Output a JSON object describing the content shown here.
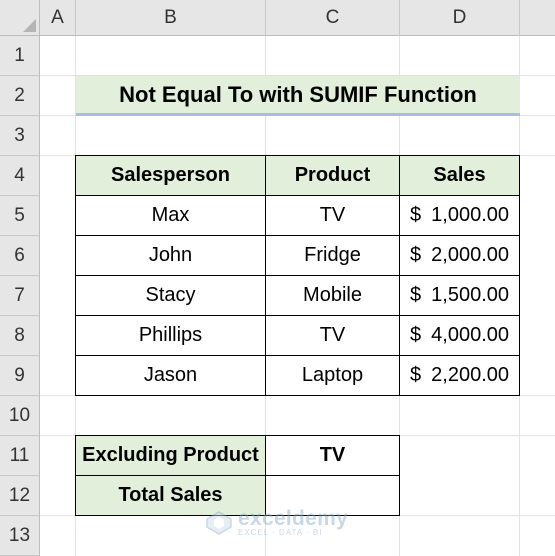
{
  "columns": [
    "A",
    "B",
    "C",
    "D"
  ],
  "rows": [
    "1",
    "2",
    "3",
    "4",
    "5",
    "6",
    "7",
    "8",
    "9",
    "10",
    "11",
    "12",
    "13"
  ],
  "title": "Not Equal To with SUMIF Function",
  "table": {
    "headers": [
      "Salesperson",
      "Product",
      "Sales"
    ],
    "rows": [
      {
        "name": "Max",
        "product": "TV",
        "currency": "$",
        "amount": "1,000.00"
      },
      {
        "name": "John",
        "product": "Fridge",
        "currency": "$",
        "amount": "2,000.00"
      },
      {
        "name": "Stacy",
        "product": "Mobile",
        "currency": "$",
        "amount": "1,500.00"
      },
      {
        "name": "Phillips",
        "product": "TV",
        "currency": "$",
        "amount": "4,000.00"
      },
      {
        "name": "Jason",
        "product": "Laptop",
        "currency": "$",
        "amount": "2,200.00"
      }
    ]
  },
  "summary": {
    "excluding_label": "Excluding Product",
    "excluding_value": "TV",
    "total_label": "Total Sales",
    "total_value": ""
  },
  "watermark": {
    "name": "exceldemy",
    "tagline": "EXCEL · DATA · BI"
  },
  "colors": {
    "header_fill": "#e2efda",
    "title_underline": "#a9bce4",
    "grid_header": "#e6e6e6"
  }
}
